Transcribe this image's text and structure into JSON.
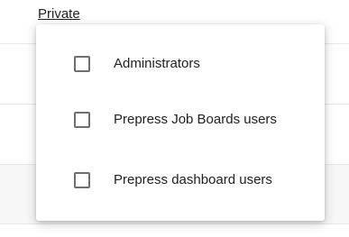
{
  "header": {
    "visibility_link": "Private"
  },
  "menu": {
    "items": [
      {
        "label": "Administrators",
        "checked": false
      },
      {
        "label": "Prepress Job Boards users",
        "checked": false
      },
      {
        "label": "Prepress dashboard users",
        "checked": false
      }
    ]
  },
  "colors": {
    "checkbox_border": "#6f6f6f",
    "text": "#212121",
    "divider": "#e8e8e8"
  }
}
